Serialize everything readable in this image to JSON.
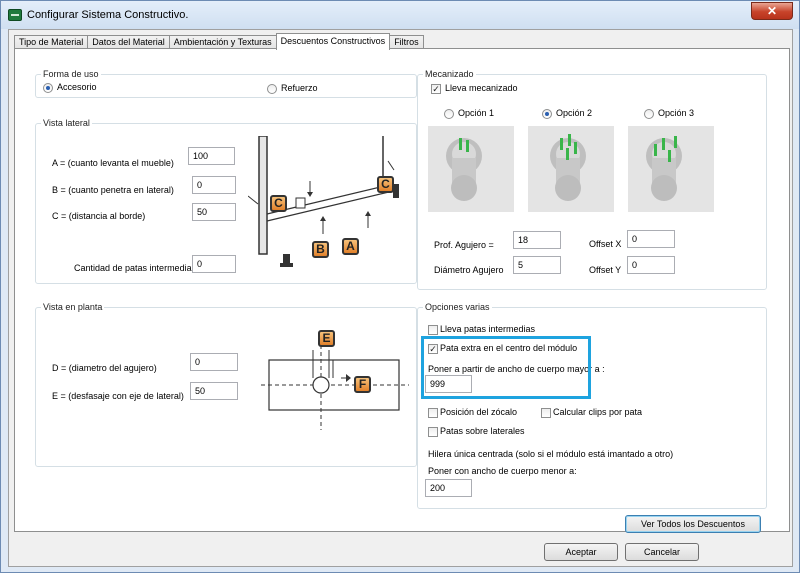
{
  "window": {
    "title": "Configurar Sistema Constructivo.",
    "close_glyph": "✕"
  },
  "tabs": [
    "Tipo de Material",
    "Datos del Material",
    "Ambientación y Texturas",
    "Descuentos Constructivos",
    "Filtros"
  ],
  "forma_uso": {
    "title": "Forma de uso",
    "accesorio": "Accesorio",
    "refuerzo": "Refuerzo",
    "selected": "Accesorio"
  },
  "vista_lateral": {
    "title": "Vista lateral",
    "a_label": "A = (cuanto levanta el mueble)",
    "a_value": "100",
    "b_label": "B = (cuanto penetra en lateral)",
    "b_value": "0",
    "c_label": "C = (distancia al borde)",
    "c_value": "50",
    "patas_label": "Cantidad de patas intermedias",
    "patas_value": "0",
    "tags": [
      "C",
      "C",
      "B",
      "A"
    ]
  },
  "mecanizado": {
    "title": "Mecanizado",
    "lleva_label": "Lleva mecanizado",
    "lleva_checked": true,
    "opcion1": "Opción 1",
    "opcion2": "Opción 2",
    "opcion3": "Opción 3",
    "selected": "Opción 2",
    "prof_label": "Prof. Agujero =",
    "prof_value": "18",
    "diam_label": "Diámetro Agujero",
    "diam_value": "5",
    "offx_label": "Offset X",
    "offx_value": "0",
    "offy_label": "Offset Y",
    "offy_value": "0"
  },
  "vista_planta": {
    "title": "Vista en planta",
    "d_label": "D = (diametro del agujero)",
    "d_value": "0",
    "e_label": "E = (desfasaje con eje de lateral)",
    "e_value": "50",
    "tags": [
      "E",
      "F"
    ]
  },
  "opciones": {
    "title": "Opciones varias",
    "patas_intermedias": "Lleva patas intermedias",
    "pata_extra": "Pata extra en el centro del módulo",
    "poner_partir": "Poner a partir de ancho de cuerpo mayor a :",
    "poner_partir_value": "999",
    "posicion_zocalo": "Posición del zócalo",
    "calcular_clips": "Calcular clips por pata",
    "patas_laterales": "Patas sobre laterales",
    "hilera": "Hilera única centrada (solo si el módulo está imantado a otro)",
    "poner_menor": "Poner con ancho de cuerpo menor a:",
    "poner_menor_value": "200",
    "check_mark": "✓"
  },
  "buttons": {
    "ver_todos": "Ver Todos los Descuentos",
    "aceptar": "Aceptar",
    "cancelar": "Cancelar"
  },
  "colors": {
    "highlight": "#1ea3df",
    "tag_orange": "#e1812a"
  }
}
